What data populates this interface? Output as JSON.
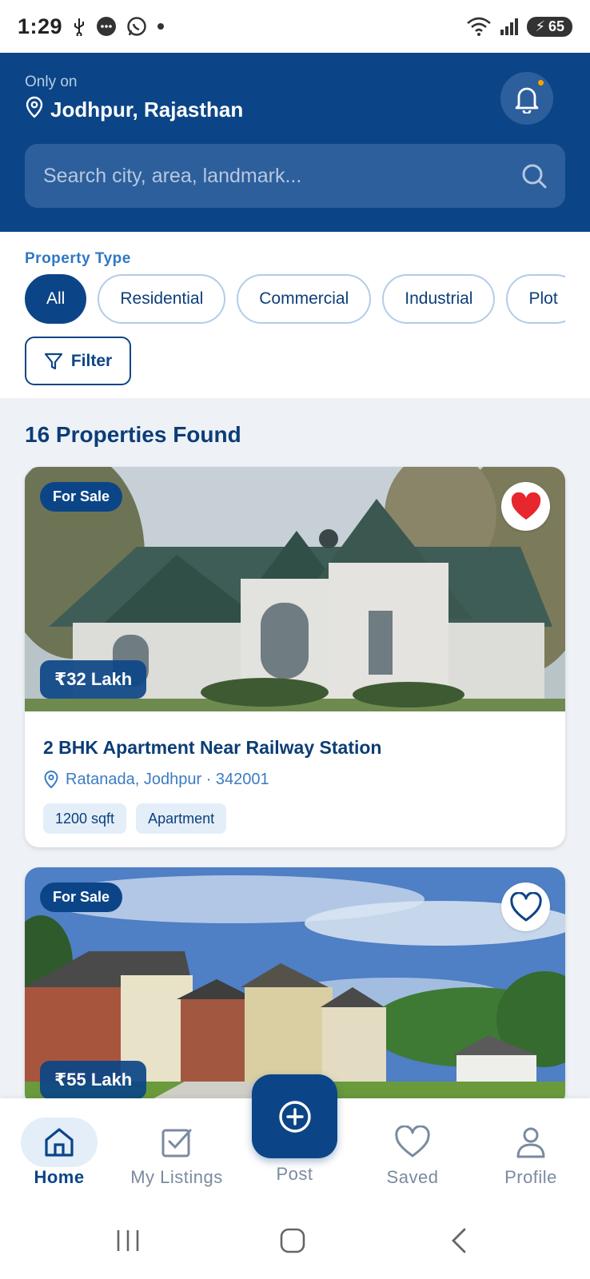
{
  "status_bar": {
    "time": "1:29",
    "battery": "65"
  },
  "header": {
    "only_on": "Only on",
    "location": "Jodhpur, Rajasthan",
    "search_placeholder": "Search city, area, landmark..."
  },
  "filters": {
    "label": "Property Type",
    "chips": [
      "All",
      "Residential",
      "Commercial",
      "Industrial",
      "Plot"
    ],
    "selected": "All",
    "filter_button": "Filter"
  },
  "results": {
    "count_text": "16 Properties Found"
  },
  "listings": [
    {
      "badge": "For Sale",
      "price": "₹32 Lakh",
      "favorited": true,
      "title": "2 BHK Apartment Near Railway Station",
      "location": "Ratanada, Jodhpur · 342001",
      "tags": [
        "1200 sqft",
        "Apartment"
      ]
    },
    {
      "badge": "For Sale",
      "price": "₹55 Lakh",
      "favorited": false
    }
  ],
  "bottom_nav": {
    "items": [
      {
        "label": "Home",
        "icon": "home-icon",
        "active": true
      },
      {
        "label": "My Listings",
        "icon": "checkbox-icon",
        "active": false
      },
      {
        "label": "Post",
        "icon": "plus-circle-icon",
        "active": false
      },
      {
        "label": "Saved",
        "icon": "heart-icon",
        "active": false
      },
      {
        "label": "Profile",
        "icon": "user-icon",
        "active": false
      }
    ]
  },
  "colors": {
    "primary": "#0c4587",
    "accent": "#f6a400",
    "favorite": "#e8262d"
  }
}
